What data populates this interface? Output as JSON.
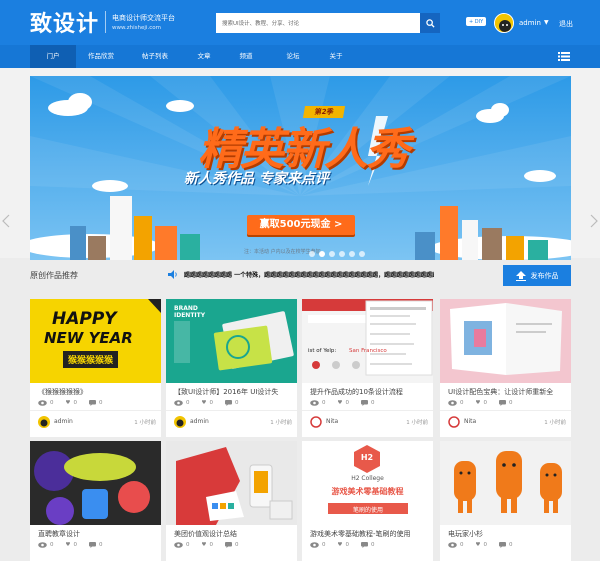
{
  "header": {
    "logo_text": "致设计",
    "logo_sub1": "电商设计师交流平台",
    "logo_sub2": "www.zhisheji.com",
    "search_placeholder": "搜索UI设计、教程、分享、讨论",
    "diy_badge": "+ DIY",
    "user_name": "admin",
    "logout": "退出"
  },
  "nav": {
    "items": [
      {
        "label": "门户"
      },
      {
        "label": "作品欣赏"
      },
      {
        "label": "帖子列表"
      },
      {
        "label": "文章"
      },
      {
        "label": "频道"
      },
      {
        "label": "论坛"
      },
      {
        "label": "关于"
      }
    ],
    "active_index": 0
  },
  "banner": {
    "season": "第2季",
    "title": "精英新人秀",
    "subtitle": "新人秀作品  专家来点评",
    "cta": "赢取500元现金 >",
    "note": "注：本活动                                               户内以及在校学生参加",
    "dot_count": 6,
    "active_dot": 1
  },
  "section": {
    "title": "原创作品推荐",
    "ticker": "踢踢踢踢踢踢踢踢 一个特殊，踢踢踢踢踢踢踢踢踢踢踢踢踢踢踢踢踢踢踢，踢踢踢踢踢踢踢踢踢踢踢踢踢",
    "publish": "发布作品"
  },
  "cards": [
    {
      "title": "《猴猴猴猴猴》",
      "views": "0",
      "likes": "0",
      "comments": "0",
      "author": "admin",
      "time": "1 小时前"
    },
    {
      "title": "【致UI设计师】2016年 UI设计失",
      "views": "0",
      "likes": "0",
      "comments": "0",
      "author": "admin",
      "time": "1 小时前"
    },
    {
      "title": "提升作品成功的10条设计流程",
      "views": "0",
      "likes": "0",
      "comments": "0",
      "author": "Nita",
      "time": "1 小时前"
    },
    {
      "title": "UI设计配色宝典：让设计师重新全",
      "views": "0",
      "likes": "0",
      "comments": "0",
      "author": "Nita",
      "time": "1 小时前"
    },
    {
      "title": "直聘教章设计",
      "views": "0",
      "likes": "0",
      "comments": "0",
      "author": "",
      "time": ""
    },
    {
      "title": "美团价值观设计总结",
      "views": "0",
      "likes": "0",
      "comments": "0",
      "author": "",
      "time": ""
    },
    {
      "title": "游戏美术零基础教程-笔刷的使用",
      "views": "0",
      "likes": "0",
      "comments": "0",
      "author": "",
      "time": ""
    },
    {
      "title": "电玩家小杉",
      "views": "0",
      "likes": "0",
      "comments": "0",
      "author": "",
      "time": ""
    }
  ],
  "thumb_text": {
    "happy": "HAPPY",
    "new_year": "NEW YEAR",
    "monkey": "猴猴猴猴猴",
    "brand": "BRAND\nIDENTITY",
    "sf": "San Francisco",
    "yelp": "ist of Yelp:",
    "h2": "H2",
    "h2_college": "H2 College",
    "game_course": "游戏美术零基础教程",
    "brush": "笔刷的使用"
  },
  "colors": {
    "brand_blue": "#1b7fe0",
    "nav_blue": "#1677d6",
    "active_nav": "#0f5fb3",
    "orange": "#ff6b1a"
  }
}
